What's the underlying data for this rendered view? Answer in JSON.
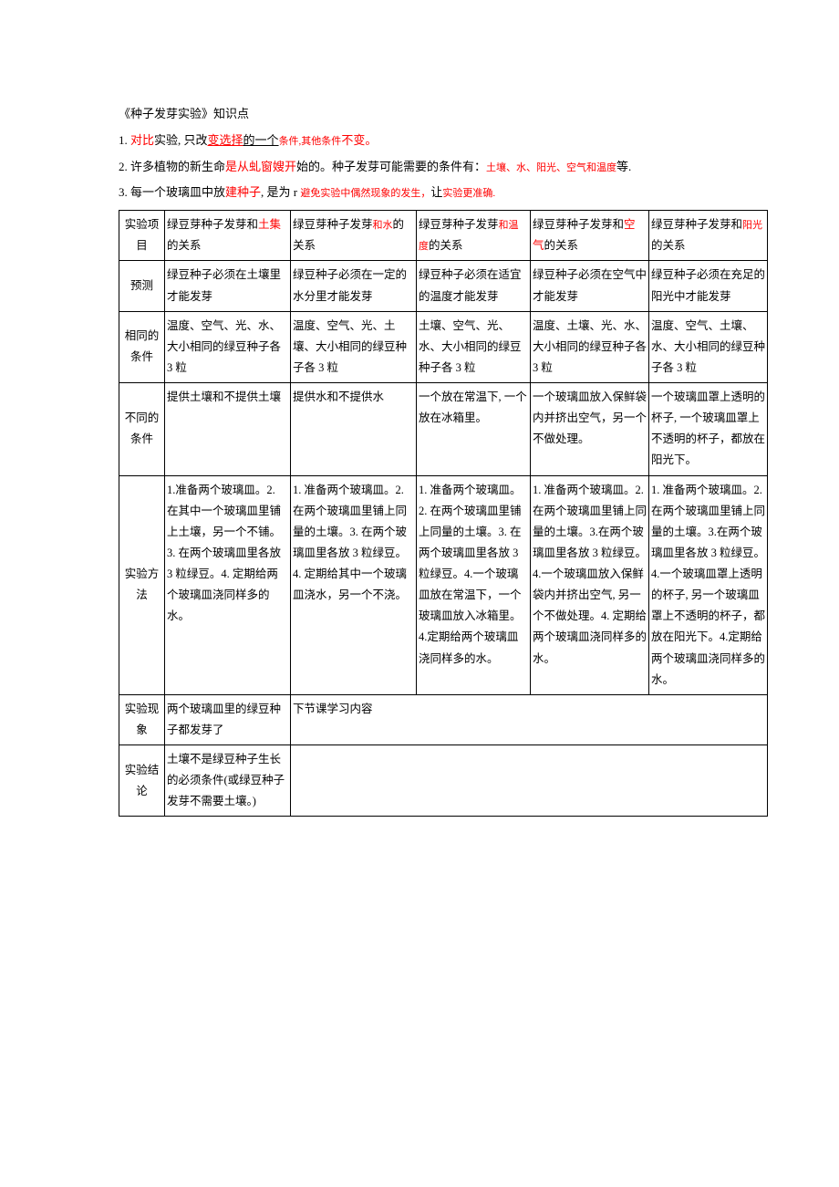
{
  "title": "《种子发芽实验》知识点",
  "intro": {
    "p1_a": "1. ",
    "p1_b": "对比",
    "p1_c": "实验, 只改",
    "p1_d": "变选择",
    "p1_e": "的一个",
    "p1_f": "条件,其他条件",
    "p1_g": "不变。",
    "p2_a": "2. 许多植物的新生命",
    "p2_b": "是从虬窗嫂开",
    "p2_c": "始的。种子发芽可能需要的条件有：",
    "p2_d": "土壤、水、阳光、空气和温度",
    "p2_e": "等.",
    "p3_a": "3. 每一个玻璃皿中放",
    "p3_b": "建种子",
    "p3_c": ", 是为 r ",
    "p3_d": "避免实验中偶然现象的发生，",
    "p3_e": "让",
    "p3_f": "实验更准确."
  },
  "rows": {
    "r0": {
      "label": "实验项目",
      "c1a": "绿豆芽种子发芽和",
      "c1b": "土集",
      "c1c": "的关系",
      "c2a": "绿豆芽种子发芽",
      "c2b": "和水",
      "c2c": "的关系",
      "c3a": "绿豆芽种子发芽",
      "c3b": "和温度",
      "c3c": "的关系",
      "c4a": "绿豆芽种子发芽和",
      "c4b": "空气",
      "c4c": "的关系",
      "c5a": "绿豆芽种子发芽和",
      "c5b": "阳光",
      "c5c": "的关系"
    },
    "r1": {
      "label": "预测",
      "c1": "绿豆种子必须在土壤里才能发芽",
      "c2": "绿豆种子必须在一定的水分里才能发芽",
      "c3": "绿豆种子必须在适宜的温度才能发芽",
      "c4": "绿豆种子必须在空气中才能发芽",
      "c5": "绿豆种子必须在充足的阳光中才能发芽"
    },
    "r2": {
      "label": "相同的条件",
      "c1": "温度、空气、光、水、大小相同的绿豆种子各 3 粒",
      "c2": "温度、空气、光、土壤、大小相同的绿豆种子各 3 粒",
      "c3": "土壤、空气、光、水、大小相同的绿豆种子各 3 粒",
      "c4": "温度、土壤、光、水、大小相同的绿豆种子各 3 粒",
      "c5": "温度、空气、土壤、水、大小相同的绿豆种子各 3 粒"
    },
    "r3": {
      "label": "不同的条件",
      "c1": "提供土壤和不提供土壤",
      "c2": "提供水和不提供水",
      "c3": "一个放在常温下, 一个放在冰箱里。",
      "c4": "一个玻璃皿放入保鲜袋内并挤出空气，另一个不做处理。",
      "c5": "一个玻璃皿罩上透明的杯子, 一个玻璃皿罩上不透明的杯子，都放在阳光下。"
    },
    "r4": {
      "label": "实验方法",
      "c1": "1.准备两个玻璃皿。2. 在其中一个玻璃皿里铺上土壤，另一个不铺。3. 在两个玻璃皿里各放 3 粒绿豆。4. 定期给两个玻璃皿浇同样多的水。",
      "c2": "1. 准备两个玻璃皿。2. 在两个玻璃皿里铺上同量的土壤。3. 在两个玻璃皿里各放 3 粒绿豆。4. 定期给其中一个玻璃皿浇水，另一个不浇。",
      "c3": "1. 准备两个玻璃皿。2. 在两个玻璃皿里铺上同量的土壤。3. 在两个玻璃皿里各放 3 粒绿豆。4.一个玻璃皿放在常温下，一个玻璃皿放入冰箱里。4.定期给两个玻璃皿浇同样多的水。",
      "c4": "1. 准备两个玻璃皿。2. 在两个玻璃皿里铺上同量的土壤。3.在两个玻璃皿里各放 3 粒绿豆。4.一个玻璃皿放入保鲜袋内并挤出空气, 另一个不做处理。4. 定期给两个玻璃皿浇同样多的水。",
      "c5": "1. 准备两个玻璃皿。2. 在两个玻璃皿里铺上同量的土壤。3.在两个玻璃皿里各放 3 粒绿豆。4.一个玻璃皿罩上透明的杯子, 另一个玻璃皿罩上不透明的杯子，都放在阳光下。4.定期给两个玻璃皿浇同样多的水。"
    },
    "r5": {
      "label": "实验现象",
      "c1": "两个玻璃皿里的绿豆种子都发芽了",
      "c2": "下节课学习内容"
    },
    "r6": {
      "label": "实验结论",
      "c1": "土壤不是绿豆种子生长的必须条件(或绿豆种子发芽不需要土壤。)"
    }
  }
}
